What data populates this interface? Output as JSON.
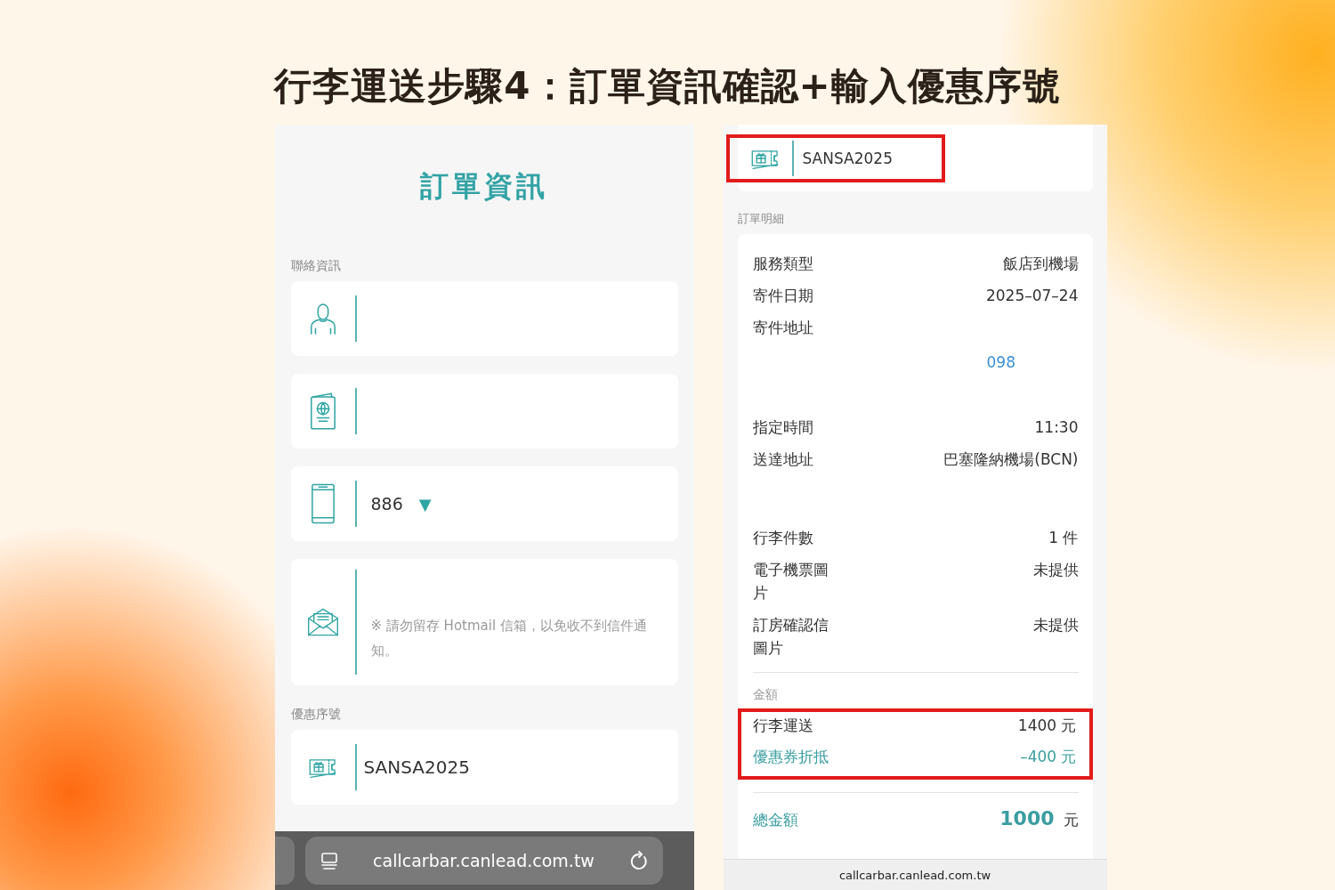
{
  "heading": "行李運送步驟4：訂單資訊確認+輸入優惠序號",
  "left_screen": {
    "title": "訂單資訊",
    "contact_label": "聯絡資訊",
    "fields": [
      {
        "kind": "person"
      },
      {
        "kind": "passport"
      },
      {
        "kind": "phone",
        "value": "886",
        "caret": "▼"
      },
      {
        "kind": "email",
        "note": "※ 請勿留存 Hotmail 信箱，以免收不到信件通知。"
      }
    ],
    "coupon_label": "優惠序號",
    "coupon": {
      "value": "SANSA2025"
    },
    "address_bar": {
      "url": "callcarbar.canlead.com.tw"
    }
  },
  "right_screen": {
    "coupon": {
      "value": "SANSA2025",
      "highlighted": true
    },
    "details_label": "訂單明細",
    "details": [
      {
        "kind": "text",
        "label": "服務類型",
        "value": "飯店到機場"
      },
      {
        "kind": "text",
        "label": "寄件日期",
        "value": "2025–07–24"
      },
      {
        "kind": "address",
        "label": "寄件地址",
        "phone": "098"
      },
      {
        "kind": "text",
        "label": "指定時間",
        "value": "11:30"
      },
      {
        "kind": "address",
        "label": "送達地址",
        "value": "巴塞隆納機場(BCN)"
      },
      {
        "kind": "text",
        "label": "行李件數",
        "value": "1 件"
      },
      {
        "kind": "text",
        "label": "電子機票圖片",
        "value": "未提供"
      },
      {
        "kind": "text",
        "label": "訂房確認信圖片",
        "value": "未提供"
      }
    ],
    "amount_label": "金額",
    "amounts_highlighted": true,
    "amounts": [
      {
        "kind": "charge",
        "label": "行李運送",
        "value": "1400 元"
      },
      {
        "kind": "discount",
        "label": "優惠券折抵",
        "value": "–400 元"
      }
    ],
    "total": {
      "label": "總金額",
      "value": "1000",
      "unit": "元"
    },
    "footer_url": "callcarbar.canlead.com.tw"
  }
}
